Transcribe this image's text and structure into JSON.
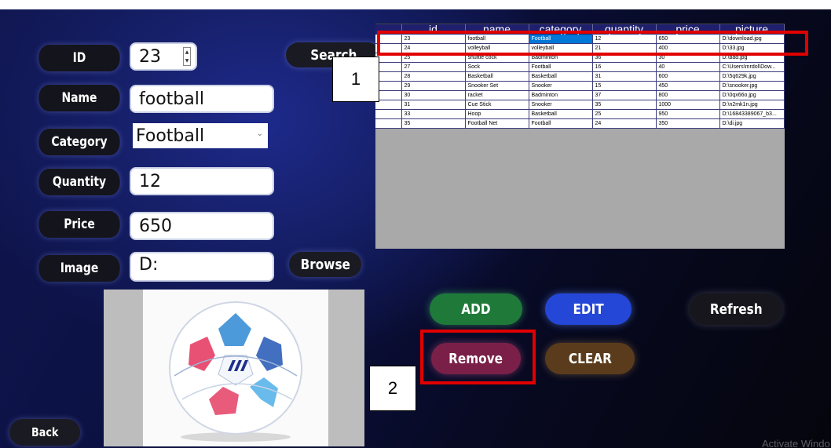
{
  "labels": {
    "id": "ID",
    "name": "Name",
    "category": "Category",
    "quantity": "Quantity",
    "price": "Price",
    "image": "Image"
  },
  "form": {
    "id_value": "23",
    "name_value": "football",
    "category_value": "Football",
    "quantity_value": "12",
    "price_value": "650",
    "image_value": "D:"
  },
  "buttons": {
    "search": "Search",
    "browse": "Browse",
    "add": "ADD",
    "edit": "EDIT",
    "refresh": "Refresh",
    "remove": "Remove",
    "clear": "CLEAR",
    "back": "Back"
  },
  "grid": {
    "columns": [
      "id",
      "name",
      "category",
      "quantity",
      "price",
      "picture"
    ],
    "rows": [
      [
        "23",
        "football",
        "Football",
        "12",
        "650",
        "D:\\download.jpg"
      ],
      [
        "24",
        "volleyball",
        "volleyball",
        "21",
        "400",
        "D:\\33.jpg"
      ],
      [
        "25",
        "shuttle cock",
        "Badminton",
        "36",
        "30",
        "D:\\bad.jpg"
      ],
      [
        "27",
        "Sock",
        "Football",
        "16",
        "40",
        "C:\\Users\\mrdol\\Dow..."
      ],
      [
        "28",
        "Basketball",
        "Basketball",
        "31",
        "600",
        "D:\\5q629k.jpg"
      ],
      [
        "29",
        "Snooker Set",
        "Snooker",
        "15",
        "450",
        "D:\\snooker.jpg"
      ],
      [
        "30",
        "racket",
        "Badminton",
        "37",
        "800",
        "D:\\0qx66o.jpg"
      ],
      [
        "31",
        "Cue Stick",
        "Snooker",
        "35",
        "1000",
        "D:\\n2mk1n.jpg"
      ],
      [
        "33",
        "Hoop",
        "Basketball",
        "25",
        "950",
        "D:\\16843389067_b3..."
      ],
      [
        "35",
        "Football Net",
        "Football",
        "24",
        "350",
        "D:\\di.jpg"
      ]
    ]
  },
  "annotations": {
    "callout_1": "1",
    "callout_2": "2",
    "annotation_color": "#e00000"
  },
  "watermark": "Activate Windo",
  "colors": {
    "add": "#1f7a3a",
    "edit": "#2447d8",
    "refresh": "#16161c",
    "remove": "#7a2048",
    "clear": "#5a3c1c"
  }
}
